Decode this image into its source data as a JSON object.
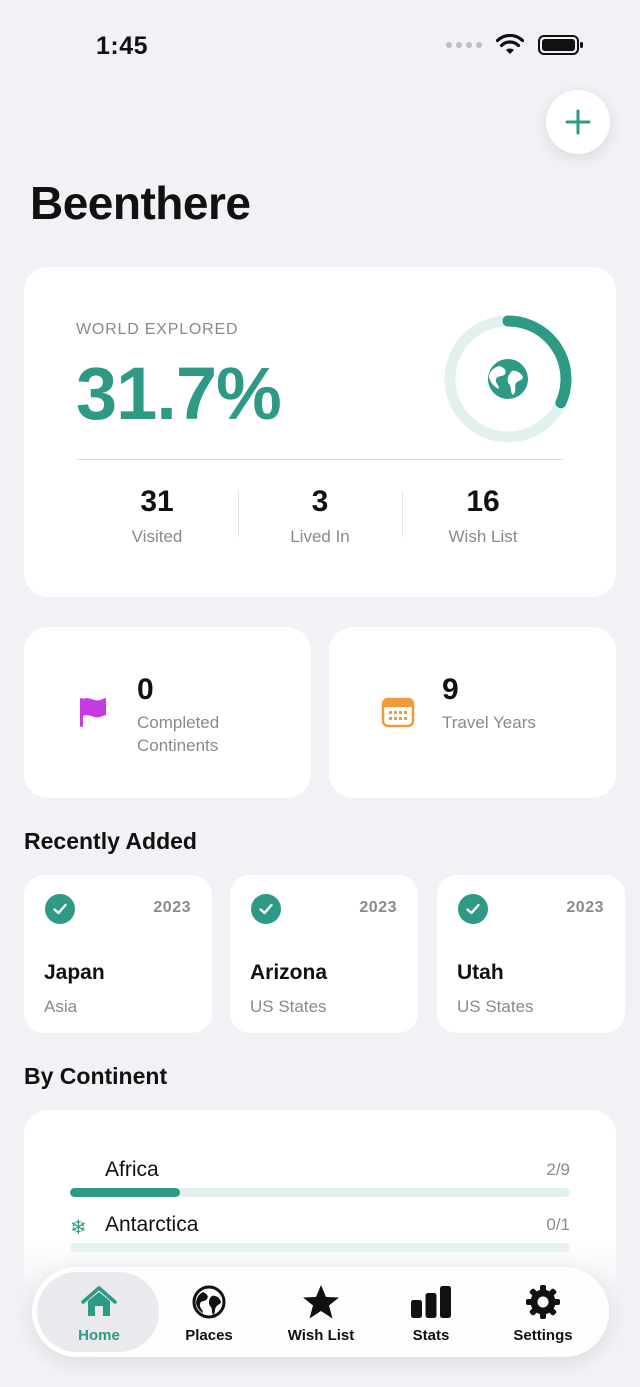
{
  "status_bar": {
    "time": "1:45"
  },
  "app": {
    "title": "Beenthere"
  },
  "world": {
    "label": "WORLD EXPLORED",
    "percent_text": "31.7%",
    "percent_value": 31.7,
    "stats": [
      {
        "value": "31",
        "label": "Visited"
      },
      {
        "value": "3",
        "label": "Lived In"
      },
      {
        "value": "16",
        "label": "Wish List"
      }
    ]
  },
  "summary": [
    {
      "value": "0",
      "label": "Completed Continents",
      "icon": "flag-icon",
      "color": "#c53be0"
    },
    {
      "value": "9",
      "label": "Travel Years",
      "icon": "calendar-icon",
      "color": "#f29a3a"
    }
  ],
  "recent": {
    "title": "Recently Added",
    "items": [
      {
        "name": "Japan",
        "category": "Asia",
        "year": "2023"
      },
      {
        "name": "Arizona",
        "category": "US States",
        "year": "2023"
      },
      {
        "name": "Utah",
        "category": "US States",
        "year": "2023"
      }
    ]
  },
  "by_continent": {
    "title": "By Continent",
    "items": [
      {
        "name": "Africa",
        "count": "2/9",
        "fraction": 0.22,
        "icon": ""
      },
      {
        "name": "Antarctica",
        "count": "0/1",
        "fraction": 0,
        "icon": "❄"
      }
    ]
  },
  "tabs": [
    {
      "label": "Home",
      "icon": "home-icon",
      "active": true
    },
    {
      "label": "Places",
      "icon": "globe-icon",
      "active": false
    },
    {
      "label": "Wish List",
      "icon": "star-icon",
      "active": false
    },
    {
      "label": "Stats",
      "icon": "bar-chart-icon",
      "active": false
    },
    {
      "label": "Settings",
      "icon": "gear-icon",
      "active": false
    }
  ],
  "colors": {
    "accent": "#2e9a86",
    "background": "#f2f2f6",
    "track": "#e3f1ee"
  }
}
